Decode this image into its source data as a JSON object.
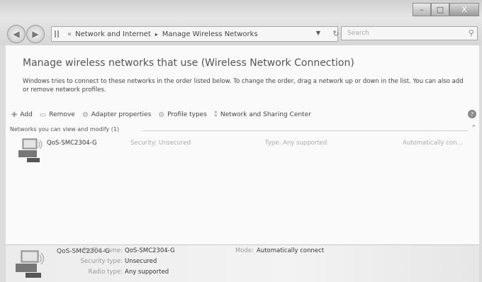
{
  "window": {
    "minimize_glyph": "–",
    "maximize_glyph": "□",
    "close_glyph": "X"
  },
  "nav": {
    "back_glyph": "◀",
    "forward_glyph": "▶",
    "breadcrumb_sep": "«",
    "path_sep": "▸",
    "breadcrumb": [
      "Network and Internet",
      "Manage Wireless Networks"
    ],
    "search_placeholder": "Search"
  },
  "page": {
    "title": "Manage wireless networks that use (Wireless Network Connection)",
    "description": "Windows tries to connect to these networks in the order listed below. To change the order, drag a network up or down in the list. You can also add or remove network profiles."
  },
  "toolbar": {
    "add": "Add",
    "remove": "Remove",
    "adapter_properties": "Adapter properties",
    "profile_types": "Profile types",
    "network_sharing_center": "Network and Sharing Center"
  },
  "group": {
    "header": "Networks you can view and modify (1)"
  },
  "networks": [
    {
      "name": "QoS-SMC2304-G",
      "security": "Security: Unsecured",
      "type": "Type: Any supported",
      "mode": "Automatically con..."
    }
  ],
  "details": {
    "name": "QoS-SMC2304-G",
    "profile_name_label": "Profile name:",
    "profile_name": "QoS-SMC2304-G",
    "security_type_label": "Security type:",
    "security_type": "Unsecured",
    "radio_type_label": "Radio type:",
    "radio_type": "Any supported",
    "mode_label": "Mode:",
    "mode": "Automatically connect"
  }
}
